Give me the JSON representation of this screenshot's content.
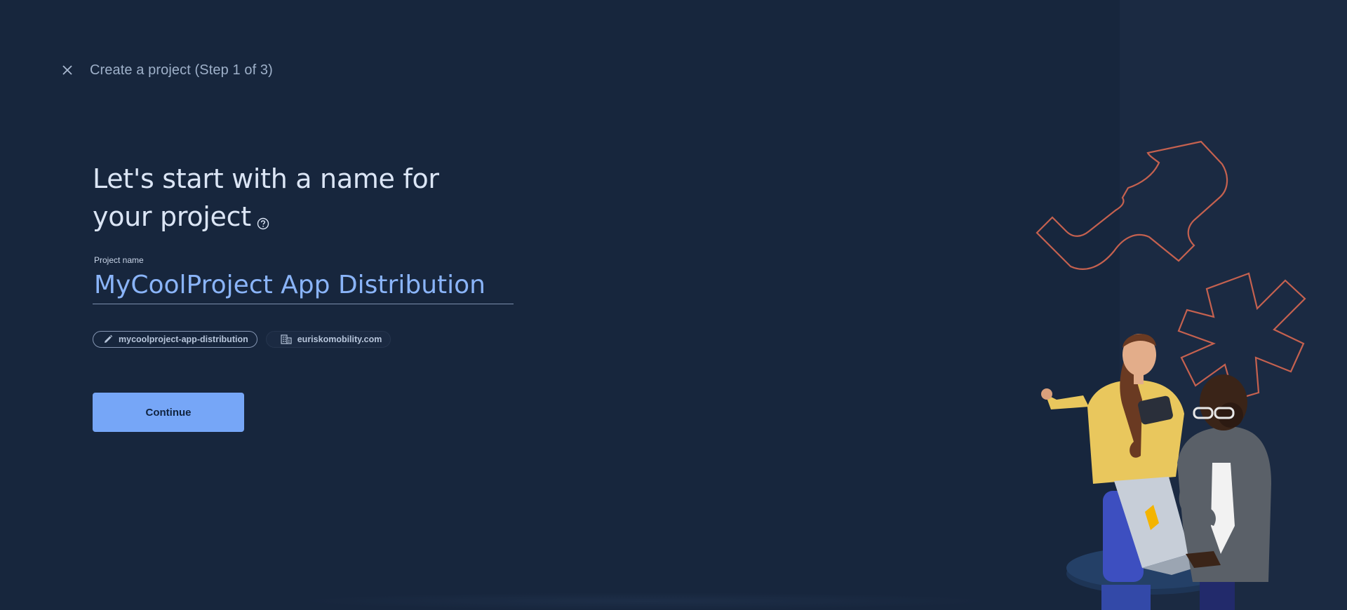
{
  "header": {
    "title": "Create a project (Step 1 of 3)",
    "close_icon": "close-icon"
  },
  "main": {
    "headline_line1": "Let's start with a name for",
    "headline_line2": "your project",
    "help_icon": "help-circle-icon",
    "project_name": {
      "label": "Project name",
      "value": "MyCoolProject App Distribution"
    },
    "chips": {
      "project_id": {
        "icon": "pencil-icon",
        "label": "mycoolproject-app-distribution"
      },
      "organization": {
        "icon": "building-icon",
        "label": "euriskomobility.com"
      }
    },
    "continue_label": "Continue"
  },
  "colors": {
    "background": "#17263d",
    "accent": "#8ab4f8",
    "button": "#76a6f7",
    "decor_outline": "#c5614f"
  },
  "illustration": {
    "icon": "developers-with-laptop-illustration"
  }
}
